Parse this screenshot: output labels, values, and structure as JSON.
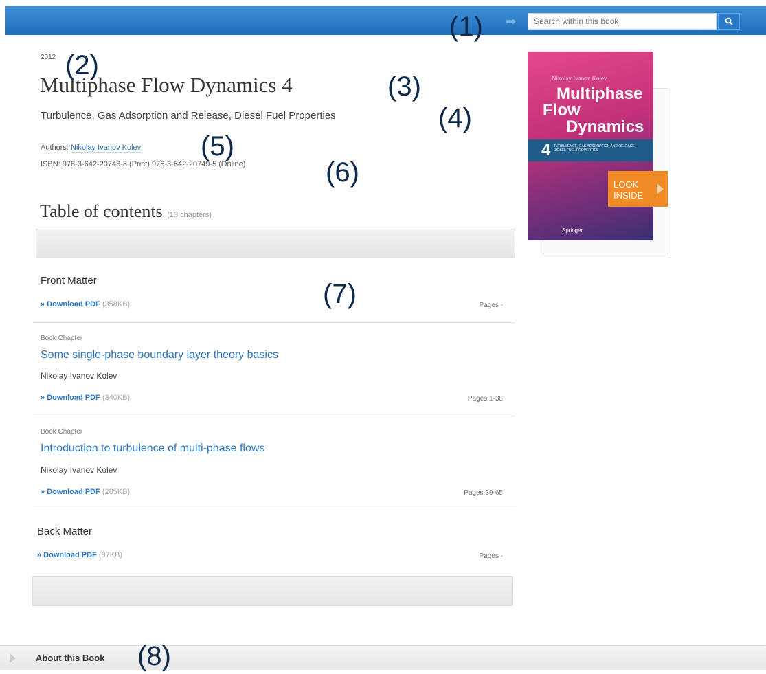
{
  "search": {
    "placeholder": "Search within this book"
  },
  "markers": [
    "(1)",
    "(2)",
    "(3)",
    "(4)",
    "(5)",
    "(6)",
    "(7)",
    "(8)"
  ],
  "book": {
    "year": "2012",
    "title": "Multiphase Flow Dynamics 4",
    "subtitle": "Turbulence, Gas Adsorption and Release, Diesel Fuel Properties",
    "authors_label": "Authors:",
    "author_name": "Nikolay Ivanov Kolev",
    "isbn_line": "ISBN: 978-3-642-20748-8 (Print) 978-3-642-20749-5 (Online)"
  },
  "toc": {
    "title": "Table of contents",
    "count": "(13 chapters)",
    "entries": [
      {
        "type": "",
        "title": "Front Matter",
        "author": "",
        "download_label": "» Download PDF",
        "size": "(358KB)",
        "pages": "Pages -"
      },
      {
        "type": "Book Chapter",
        "title": "Some single-phase boundary layer theory basics",
        "author": "Nikolay Ivanov Kolev",
        "download_label": "» Download PDF",
        "size": "(340KB)",
        "pages": "Pages 1-38"
      },
      {
        "type": "Book Chapter",
        "title": "Introduction to turbulence of multi-phase flows",
        "author": "Nikolay Ivanov Kolev",
        "download_label": "» Download PDF",
        "size": "(285KB)",
        "pages": "Pages 39-65"
      },
      {
        "type": "",
        "title": "Back Matter",
        "author": "",
        "download_label": "» Download PDF",
        "size": "(97KB)",
        "pages": "Pages -"
      }
    ]
  },
  "cover": {
    "author": "Nikolay Ivanov Kolev",
    "title_lines": [
      "Multiphase",
      "Flow",
      "Dynamics"
    ],
    "volume": "4",
    "subtitle": "TURBULENCE, GAS ADSORPTION AND RELEASE, DIESEL FUEL PROPERTIES",
    "publisher": "Springer"
  },
  "look_inside": {
    "line1": "LOOK",
    "line2": "INSIDE"
  },
  "about": {
    "label": "About this Book"
  },
  "colors": {
    "topbar": "#1f6db8",
    "link": "#2a79c6",
    "look_inside": "#f08a24"
  }
}
